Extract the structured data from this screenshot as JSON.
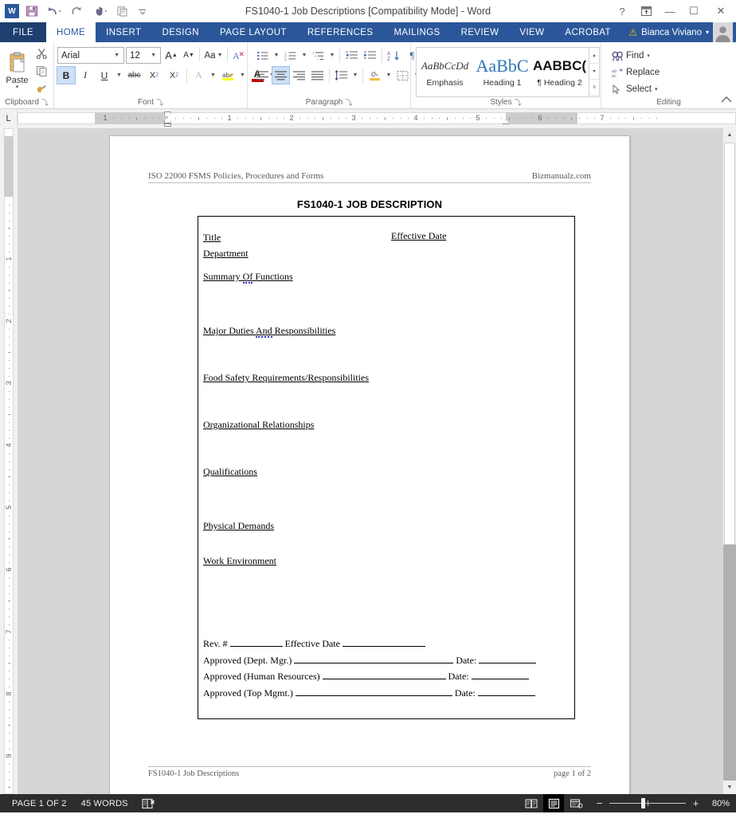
{
  "window": {
    "title": "FS1040-1 Job Descriptions [Compatibility Mode] - Word",
    "help_icon": "?",
    "ribbon_display_icon": "ribbon-display-options",
    "minimize_icon": "—",
    "restore_icon": "☐",
    "close_icon": "✕"
  },
  "quick_access": {
    "app_logo": "W",
    "items": [
      {
        "name": "save",
        "icon": "save-icon"
      },
      {
        "name": "undo",
        "icon": "undo-icon"
      },
      {
        "name": "redo",
        "icon": "redo-icon"
      },
      {
        "name": "touch-mouse-mode",
        "icon": "touch-mode-icon"
      },
      {
        "name": "print-preview",
        "icon": "print-preview-icon"
      },
      {
        "name": "customize-quick-access-toolbar",
        "icon": "chevron-down-icon"
      }
    ]
  },
  "tabs": {
    "file": "FILE",
    "items": [
      "HOME",
      "INSERT",
      "DESIGN",
      "PAGE LAYOUT",
      "REFERENCES",
      "MAILINGS",
      "REVIEW",
      "VIEW",
      "ACROBAT"
    ],
    "active": "HOME"
  },
  "account": {
    "name": "Bianca Viviano",
    "warning_icon": "warning-icon",
    "dropdown_icon": "▾"
  },
  "ribbon": {
    "groups": [
      {
        "label": "Clipboard",
        "launcher": "⤵"
      },
      {
        "label": "Font",
        "launcher": "⤵"
      },
      {
        "label": "Paragraph",
        "launcher": "⤵"
      },
      {
        "label": "Styles",
        "launcher": "⤵"
      },
      {
        "label": "Editing",
        "launcher": ""
      }
    ],
    "clipboard": {
      "paste_label": "Paste",
      "paste_dropdown": "▾",
      "cut": "cut-icon",
      "copy": "copy-icon",
      "format_painter": "format-painter-icon"
    },
    "font": {
      "font_family_value": "Arial",
      "font_size_value": "12",
      "grow_font": "A",
      "shrink_font": "A",
      "change_case": "Aa",
      "clear_formatting": "clear-formatting-icon",
      "bold": "B",
      "italic": "I",
      "underline": "U",
      "strikethrough": "abc",
      "subscript": "X",
      "superscript": "X",
      "text_effects": "A",
      "highlight": "highlight-icon",
      "font_color": "A",
      "dropdown": "▾"
    },
    "paragraph": {
      "bullets": "bullets-icon",
      "numbering": "numbering-icon",
      "multilevel": "multilevel-list-icon",
      "decrease_indent": "decrease-indent-icon",
      "increase_indent": "increase-indent-icon",
      "sort": "sort-icon",
      "show_marks": "¶",
      "align_left": "align-left-icon",
      "align_center": "align-center-icon",
      "align_right": "align-right-icon",
      "justify": "justify-icon",
      "line_spacing": "line-spacing-icon",
      "shading": "shading-icon",
      "borders": "borders-icon"
    },
    "styles": {
      "items": [
        {
          "preview": "AaBbCcDd",
          "label": "Emphasis"
        },
        {
          "preview": "AaBbC",
          "label": "Heading 1"
        },
        {
          "preview": "AABBC(",
          "label": "¶ Heading 2"
        }
      ],
      "scroll_up": "▴",
      "scroll_down": "▾",
      "more": "≡"
    },
    "editing": {
      "find": "Find",
      "find_dropdown": "▾",
      "replace": "Replace",
      "select": "Select",
      "select_dropdown": "▾"
    },
    "collapse": "collapse-ribbon-icon"
  },
  "ruler": {
    "tab_stop_selector": "L",
    "horizontal_numbers": [
      "1",
      "1",
      "2",
      "3",
      "4",
      "5"
    ],
    "vertical_numbers": [
      "1",
      "2",
      "3",
      "4",
      "5",
      "6",
      "7",
      "8"
    ]
  },
  "document": {
    "header": {
      "left": "ISO 22000 FSMS Policies, Procedures and Forms",
      "right": "Bizmanualz.com"
    },
    "title": "FS1040-1 JOB DESCRIPTION",
    "fields": {
      "title": "Title",
      "effective_date": "Effective Date",
      "department": "Department",
      "summary_of_functions_pre": "Summary ",
      "summary_of_functions_sq": "Of",
      "summary_of_functions_post": " Functions",
      "major_duties_pre": "Major Duties ",
      "major_duties_sq": "And",
      "major_duties_post": " Responsibilities",
      "food_safety": "Food Safety Requirements/Responsibilities",
      "organizational_relationships": "Organizational Relationships",
      "qualifications": "Qualifications",
      "physical_demands": "Physical Demands",
      "work_environment": "Work Environment"
    },
    "signature_block": {
      "rev_label": "Rev. #",
      "rev_eff_label": "Effective Date",
      "rows": [
        {
          "label": "Approved (Dept. Mgr.)",
          "date_label": "Date:"
        },
        {
          "label": "Approved (Human Resources)",
          "date_label": "Date:"
        },
        {
          "label": "Approved (Top Mgmt.)",
          "date_label": "Date:"
        }
      ]
    },
    "footer": {
      "left": "FS1040-1 Job Descriptions",
      "right": "page 1 of 2"
    }
  },
  "status_bar": {
    "page": "PAGE 1 OF 2",
    "words": "45 WORDS",
    "proofing_icon": "proofing-errors-icon",
    "views": [
      {
        "name": "read-mode",
        "icon": "read-mode-icon",
        "selected": false
      },
      {
        "name": "print-layout",
        "icon": "print-layout-icon",
        "selected": true
      },
      {
        "name": "web-layout",
        "icon": "web-layout-icon",
        "selected": false
      }
    ],
    "zoom_out": "−",
    "zoom_in": "+",
    "zoom_value": "80%"
  },
  "colors": {
    "ribbon_blue": "#2b579a",
    "file_tab": "#1e3f6f",
    "canvas_gray": "#d6d6d6",
    "status_dark": "#2d2d2d",
    "grammar_blue": "#3333cc"
  }
}
